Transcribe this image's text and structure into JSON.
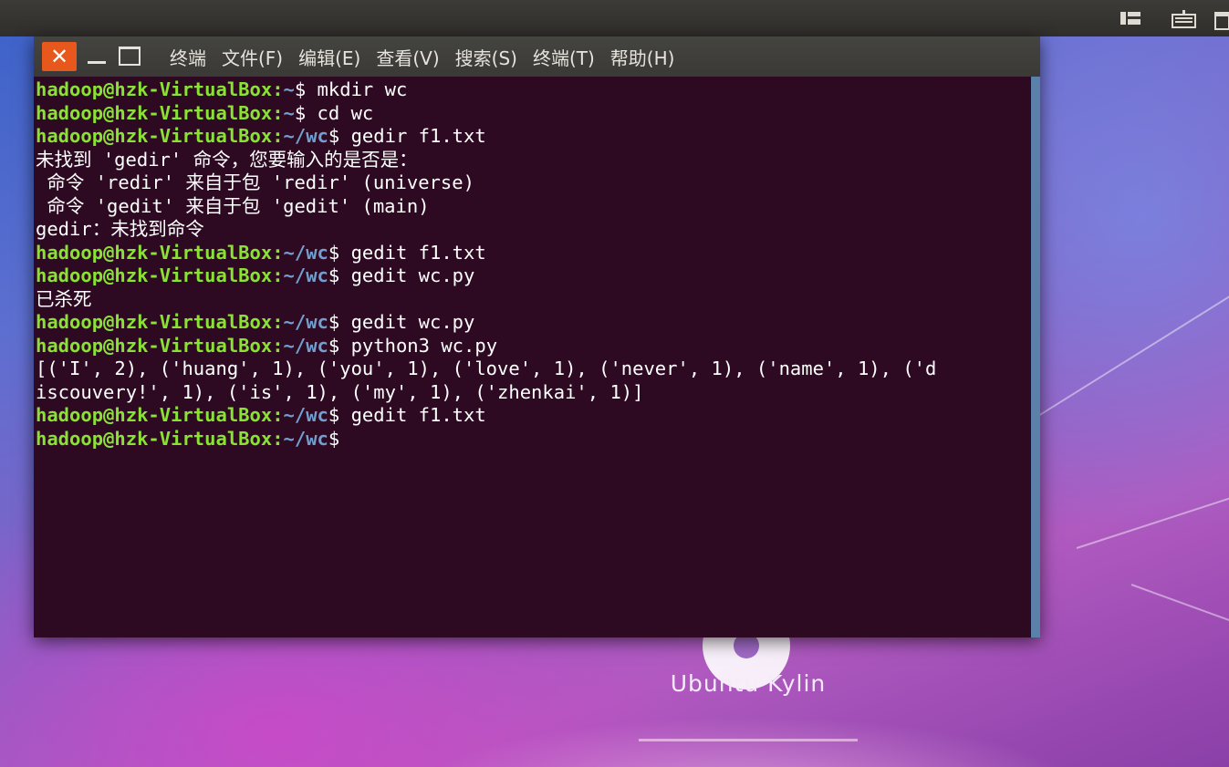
{
  "top_panel": {
    "icons": [
      "input-method-icon",
      "keyboard-icon",
      "calendar-icon"
    ]
  },
  "desktop": {
    "logo_text": "Ubuntu Kylin"
  },
  "terminal": {
    "window_title": "终端",
    "menu": [
      "文件(F)",
      "编辑(E)",
      "查看(V)",
      "搜索(S)",
      "终端(T)",
      "帮助(H)"
    ],
    "lines": [
      {
        "type": "prompt",
        "user": "hadoop@hzk-VirtualBox",
        "path": "~",
        "cmd": " mkdir wc"
      },
      {
        "type": "prompt",
        "user": "hadoop@hzk-VirtualBox",
        "path": "~",
        "cmd": " cd wc"
      },
      {
        "type": "prompt",
        "user": "hadoop@hzk-VirtualBox",
        "path": "~/wc",
        "cmd": " gedir f1.txt"
      },
      {
        "type": "output",
        "text": "未找到 'gedir' 命令，您要输入的是否是："
      },
      {
        "type": "output",
        "text": " 命令 'redir' 来自于包 'redir' (universe)"
      },
      {
        "type": "output",
        "text": " 命令 'gedit' 来自于包 'gedit' (main)"
      },
      {
        "type": "output",
        "text": "gedir：未找到命令"
      },
      {
        "type": "prompt",
        "user": "hadoop@hzk-VirtualBox",
        "path": "~/wc",
        "cmd": " gedit f1.txt"
      },
      {
        "type": "prompt",
        "user": "hadoop@hzk-VirtualBox",
        "path": "~/wc",
        "cmd": " gedit wc.py"
      },
      {
        "type": "output",
        "text": "已杀死"
      },
      {
        "type": "prompt",
        "user": "hadoop@hzk-VirtualBox",
        "path": "~/wc",
        "cmd": " gedit wc.py"
      },
      {
        "type": "prompt",
        "user": "hadoop@hzk-VirtualBox",
        "path": "~/wc",
        "cmd": " python3 wc.py"
      },
      {
        "type": "output",
        "text": "[('I', 2), ('huang', 1), ('you', 1), ('love', 1), ('never', 1), ('name', 1), ('d"
      },
      {
        "type": "output",
        "text": "iscouvery!', 1), ('is', 1), ('my', 1), ('zhenkai', 1)]"
      },
      {
        "type": "prompt",
        "user": "hadoop@hzk-VirtualBox",
        "path": "~/wc",
        "cmd": " gedit f1.txt"
      },
      {
        "type": "prompt",
        "user": "hadoop@hzk-VirtualBox",
        "path": "~/wc",
        "cmd": ""
      }
    ]
  },
  "colors": {
    "terminal_bg": "#2d0a22",
    "prompt_user": "#8ae234",
    "prompt_path": "#729fcf",
    "close_button": "#e8571c"
  }
}
